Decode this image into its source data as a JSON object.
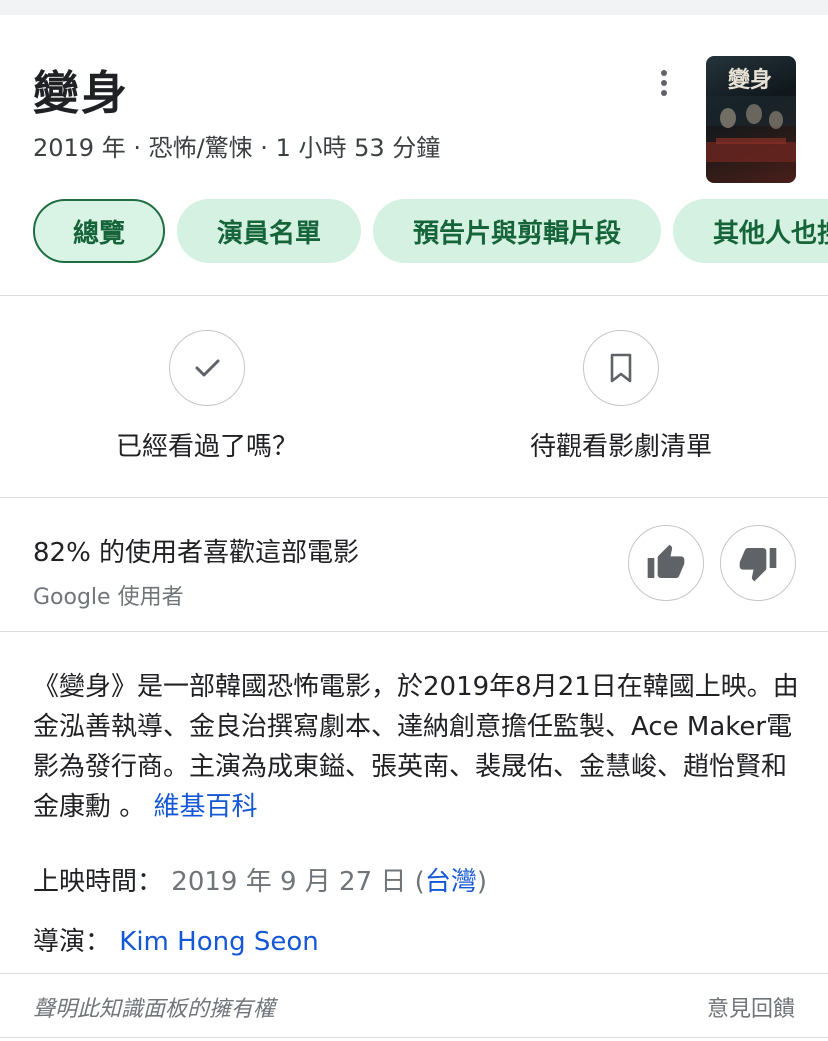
{
  "header": {
    "title": "變身",
    "subtitle": "2019 年 · 恐怖/驚悚 · 1 小時 53 分鐘",
    "poster_title": "變身"
  },
  "chips": [
    {
      "label": "總覽",
      "active": true
    },
    {
      "label": "演員名單",
      "active": false
    },
    {
      "label": "預告片與剪輯片段",
      "active": false
    },
    {
      "label": "其他人也搜尋了",
      "active": false
    }
  ],
  "actions": {
    "watched_label": "已經看過了嗎？",
    "watchlist_label": "待觀看影劇清單"
  },
  "rating": {
    "main": "82% 的使用者喜歡這部電影",
    "source": "Google 使用者"
  },
  "description": {
    "text": "《變身》是一部韓國恐怖電影，於2019年8月21日在韓國上映。由金泓善執導、金良治撰寫劇本、達納創意擔任監製、Ace Maker電影為發行商。主演為成東鎰、張英南、裴晟佑、金慧峻、趙怡賢和金康勳 。",
    "source_link": "維基百科"
  },
  "release": {
    "label": "上映時間：",
    "value": "2019 年 9 月 27 日",
    "open_paren": " (",
    "region_link": "台灣",
    "close_paren": ")"
  },
  "director": {
    "label": "導演：",
    "value_link": "Kim Hong Seon"
  },
  "footer": {
    "ownership": "聲明此知識面板的擁有權",
    "feedback": "意見回饋"
  },
  "colors": {
    "chip_bg": "#d5f1e1",
    "chip_text": "#15643a",
    "link": "#1558d6",
    "secondary_text": "#70757a"
  }
}
